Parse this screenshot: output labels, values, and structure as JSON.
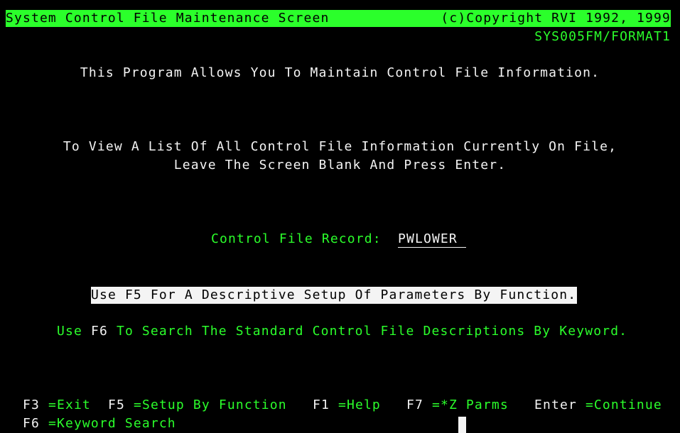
{
  "header": {
    "title": "System Control File Maintenance Screen",
    "copyright": "(c)Copyright RVI 1992, 1999",
    "format_id": "SYS005FM/FORMAT1"
  },
  "intro": {
    "line1": "This Program Allows You To Maintain Control File Information.",
    "line2": "To View A List Of All Control File Information Currently On File,",
    "line3": "Leave The Screen Blank And Press Enter."
  },
  "record_field": {
    "label": "Control File Record:",
    "value": "PWLOWER"
  },
  "notes": {
    "f5": "Use F5 For A Descriptive Setup Of Parameters By Function.",
    "f6_prefix": "Use",
    "f6_key": "F6",
    "f6_text": "To Search The Standard Control File Descriptions By Keyword."
  },
  "function_keys": [
    {
      "key": "F3",
      "label": "=Exit"
    },
    {
      "key": "F5",
      "label": "=Setup By Function"
    },
    {
      "key": "F1",
      "label": "=Help"
    },
    {
      "key": "F7",
      "label": "=*Z Parms"
    },
    {
      "key": "Enter",
      "label": "=Continue"
    },
    {
      "key": "F6",
      "label": "=Keyword Search"
    }
  ],
  "colors": {
    "background": "#000000",
    "green": "#2bff2b",
    "white": "#f4f4f4"
  }
}
